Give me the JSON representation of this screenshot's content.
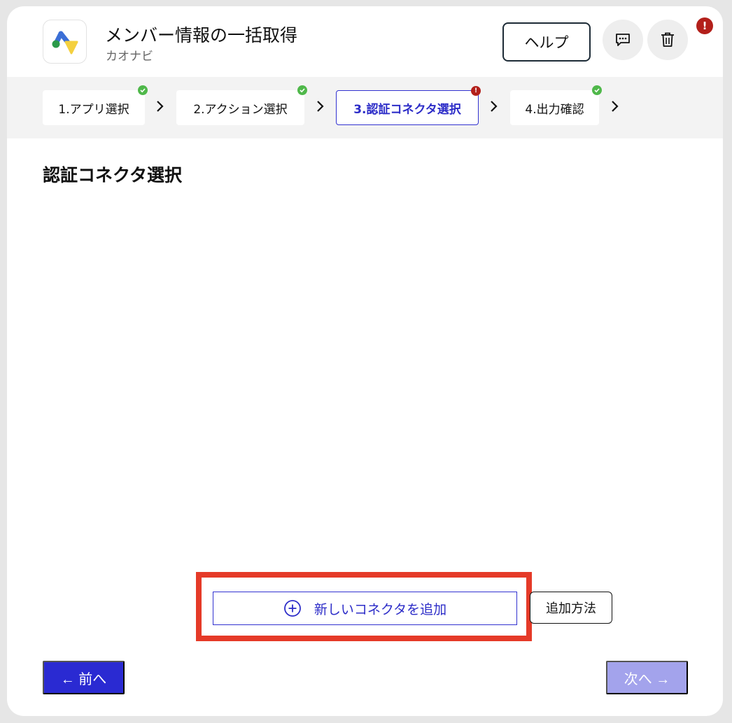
{
  "header": {
    "title": "メンバー情報の一括取得",
    "subtitle": "カオナビ",
    "help_label": "ヘルプ",
    "alert_badge": "!"
  },
  "stepper": {
    "steps": [
      {
        "label": "1.アプリ選択",
        "status": "complete"
      },
      {
        "label": "2.アクション選択",
        "status": "complete"
      },
      {
        "label": "3.認証コネクタ選択",
        "status": "error"
      },
      {
        "label": "4.出力確認",
        "status": "complete"
      }
    ],
    "error_mark": "!"
  },
  "main": {
    "section_title": "認証コネクタ選択",
    "add_connector_label": "新しいコネクタを追加",
    "howto_label": "追加方法"
  },
  "footer": {
    "prev_label": "← 前へ",
    "next_label": "次へ →"
  },
  "colors": {
    "accent": "#2a2ad2",
    "accent_disabled": "#a3a3ec",
    "error": "#b3201b",
    "success": "#4fb84a",
    "highlight": "#e53a28"
  }
}
